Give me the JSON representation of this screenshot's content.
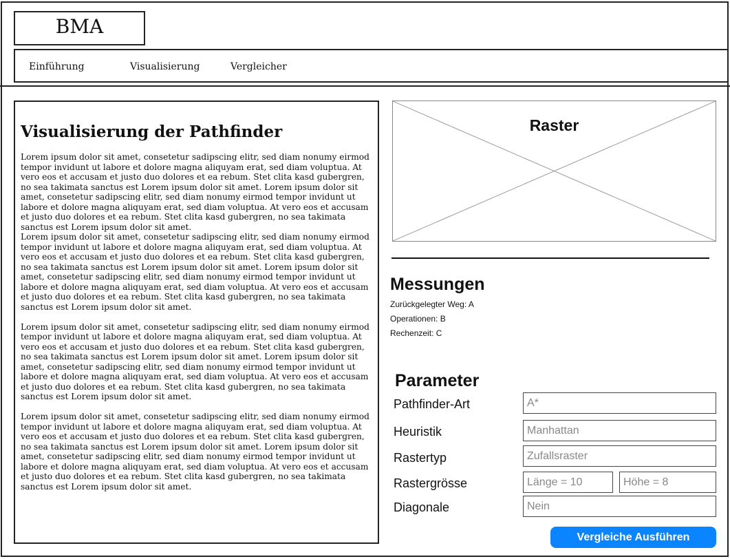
{
  "header": {
    "logo_text": "BMA",
    "nav": [
      {
        "label": "Einführung"
      },
      {
        "label": "Visualisierung"
      },
      {
        "label": "Vergleicher"
      }
    ]
  },
  "main": {
    "title": "Visualisierung der Pathfinder",
    "paragraphs": [
      "Lorem ipsum dolor sit amet, consetetur sadipscing elitr, sed diam nonumy eirmod tempor invidunt ut labore et dolore magna aliquyam erat, sed diam voluptua. At vero eos et accusam et justo duo dolores et ea rebum. Stet clita kasd gubergren, no sea takimata sanctus est Lorem ipsum dolor sit amet. Lorem ipsum dolor sit amet, consetetur sadipscing elitr, sed diam nonumy eirmod tempor invidunt ut labore et dolore magna aliquyam erat, sed diam voluptua. At vero eos et accusam et justo duo dolores et ea rebum. Stet clita kasd gubergren, no sea takimata sanctus est Lorem ipsum dolor sit amet.",
      "Lorem ipsum dolor sit amet, consetetur sadipscing elitr, sed diam nonumy eirmod tempor invidunt ut labore et dolore magna aliquyam erat, sed diam voluptua. At vero eos et accusam et justo duo dolores et ea rebum. Stet clita kasd gubergren, no sea takimata sanctus est Lorem ipsum dolor sit amet. Lorem ipsum dolor sit amet, consetetur sadipscing elitr, sed diam nonumy eirmod tempor invidunt ut labore et dolore magna aliquyam erat, sed diam voluptua. At vero eos et accusam et justo duo dolores et ea rebum. Stet clita kasd gubergren, no sea takimata sanctus est Lorem ipsum dolor sit amet.",
      "Lorem ipsum dolor sit amet, consetetur sadipscing elitr, sed diam nonumy eirmod tempor invidunt ut labore et dolore magna aliquyam erat, sed diam voluptua. At vero eos et accusam et justo duo dolores et ea rebum. Stet clita kasd gubergren, no sea takimata sanctus est Lorem ipsum dolor sit amet. Lorem ipsum dolor sit amet, consetetur sadipscing elitr, sed diam nonumy eirmod tempor invidunt ut labore et dolore magna aliquyam erat, sed diam voluptua. At vero eos et accusam et justo duo dolores et ea rebum. Stet clita kasd gubergren, no sea takimata sanctus est Lorem ipsum dolor sit amet.",
      "Lorem ipsum dolor sit amet, consetetur sadipscing elitr, sed diam nonumy eirmod tempor invidunt ut labore et dolore magna aliquyam erat, sed diam voluptua. At vero eos et accusam et justo duo dolores et ea rebum. Stet clita kasd gubergren, no sea takimata sanctus est Lorem ipsum dolor sit amet. Lorem ipsum dolor sit amet, consetetur sadipscing elitr, sed diam nonumy eirmod tempor invidunt ut labore et dolore magna aliquyam erat, sed diam voluptua. At vero eos et accusam et justo duo dolores et ea rebum. Stet clita kasd gubergren, no sea takimata sanctus est Lorem ipsum dolor sit amet."
    ]
  },
  "raster": {
    "label": "Raster"
  },
  "measurements": {
    "title": "Messungen",
    "items": [
      "Zurückgelegter Weg: A",
      "Operationen: B",
      "Rechenzeit: C"
    ]
  },
  "parameters": {
    "title": "Parameter",
    "pathfinder": {
      "label": "Pathfinder-Art",
      "value": "A*"
    },
    "heuristic": {
      "label": "Heuristik",
      "value": "Manhattan"
    },
    "grid_type": {
      "label": "Rastertyp",
      "value": "Zufallsraster"
    },
    "grid_size": {
      "label": "Rastergrösse",
      "length": "Länge = 10",
      "height": "Höhe = 8"
    },
    "diagonal": {
      "label": "Diagonale",
      "value": "Nein"
    }
  },
  "run_button_label": "Vergleiche Ausführen"
}
